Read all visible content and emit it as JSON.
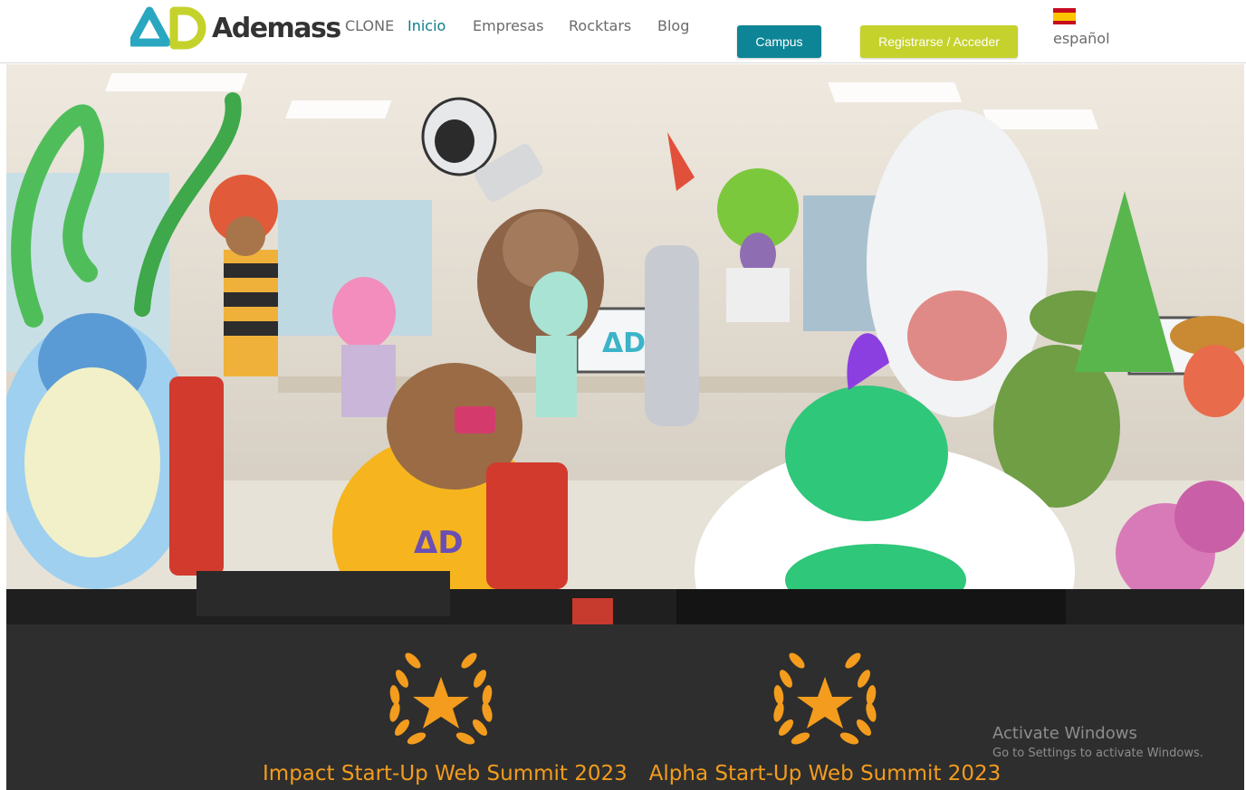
{
  "header": {
    "logo_text": "Ademass",
    "nav": [
      {
        "label": "CLONE",
        "active": false
      },
      {
        "label": "Inicio",
        "active": true
      },
      {
        "label": "Empresas",
        "active": false
      },
      {
        "label": "Rocktars",
        "active": false
      },
      {
        "label": "Blog",
        "active": false
      }
    ],
    "campus_label": "Campus",
    "register_label": "Registrarse / Acceder",
    "language_label": "español",
    "language_flag": "spain-flag-icon"
  },
  "hero": {
    "image": "office-illustration-monsters",
    "monitor_logo": "ΔD",
    "shirt_logo": "ΔD"
  },
  "awards": [
    {
      "icon": "laurel-star-icon",
      "title": "Impact Start-Up Web Summit 2023"
    },
    {
      "icon": "laurel-star-icon",
      "title": "Alpha Start-Up Web Summit 2023"
    }
  ],
  "watermark": {
    "title": "Activate Windows",
    "subtitle": "Go to Settings to activate Windows."
  },
  "colors": {
    "brand_teal": "#0e8596",
    "brand_lime": "#c5d22b",
    "award_orange": "#f39c1e",
    "awards_bg": "#2e2e2e"
  }
}
